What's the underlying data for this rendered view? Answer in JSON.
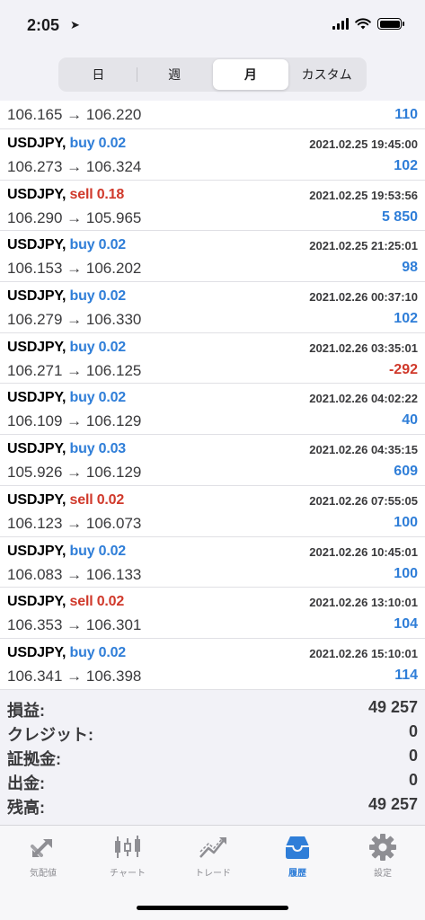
{
  "status": {
    "time": "2:05",
    "time_arrow": "➤"
  },
  "tabs": [
    "日",
    "週",
    "月",
    "カスタム"
  ],
  "active_tab_index": 2,
  "partial_row": {
    "prices": "106.165 → 106.220",
    "profit": "110"
  },
  "deals": [
    {
      "symbol": "USDJPY,",
      "side": "buy",
      "volume": "0.02",
      "datetime": "2021.02.25 19:45:00",
      "prices": "106.273 → 106.324",
      "profit": "102"
    },
    {
      "symbol": "USDJPY,",
      "side": "sell",
      "volume": "0.18",
      "datetime": "2021.02.25 19:53:56",
      "prices": "106.290 → 105.965",
      "profit": "5 850"
    },
    {
      "symbol": "USDJPY,",
      "side": "buy",
      "volume": "0.02",
      "datetime": "2021.02.25 21:25:01",
      "prices": "106.153 → 106.202",
      "profit": "98"
    },
    {
      "symbol": "USDJPY,",
      "side": "buy",
      "volume": "0.02",
      "datetime": "2021.02.26 00:37:10",
      "prices": "106.279 → 106.330",
      "profit": "102"
    },
    {
      "symbol": "USDJPY,",
      "side": "buy",
      "volume": "0.02",
      "datetime": "2021.02.26 03:35:01",
      "prices": "106.271 → 106.125",
      "profit": "-292"
    },
    {
      "symbol": "USDJPY,",
      "side": "buy",
      "volume": "0.02",
      "datetime": "2021.02.26 04:02:22",
      "prices": "106.109 → 106.129",
      "profit": "40"
    },
    {
      "symbol": "USDJPY,",
      "side": "buy",
      "volume": "0.03",
      "datetime": "2021.02.26 04:35:15",
      "prices": "105.926 → 106.129",
      "profit": "609"
    },
    {
      "symbol": "USDJPY,",
      "side": "sell",
      "volume": "0.02",
      "datetime": "2021.02.26 07:55:05",
      "prices": "106.123 → 106.073",
      "profit": "100"
    },
    {
      "symbol": "USDJPY,",
      "side": "buy",
      "volume": "0.02",
      "datetime": "2021.02.26 10:45:01",
      "prices": "106.083 → 106.133",
      "profit": "100"
    },
    {
      "symbol": "USDJPY,",
      "side": "sell",
      "volume": "0.02",
      "datetime": "2021.02.26 13:10:01",
      "prices": "106.353 → 106.301",
      "profit": "104"
    },
    {
      "symbol": "USDJPY,",
      "side": "buy",
      "volume": "0.02",
      "datetime": "2021.02.26 15:10:01",
      "prices": "106.341 → 106.398",
      "profit": "114"
    }
  ],
  "summary": [
    {
      "label": "損益:",
      "value": "49 257"
    },
    {
      "label": "クレジット:",
      "value": "0"
    },
    {
      "label": "証拠金:",
      "value": "0"
    },
    {
      "label": "出金:",
      "value": "0"
    },
    {
      "label": "残高:",
      "value": "49 257"
    }
  ],
  "tabbar": [
    {
      "label": "気配値",
      "icon": "quotes-icon"
    },
    {
      "label": "チャート",
      "icon": "chart-icon"
    },
    {
      "label": "トレード",
      "icon": "trade-icon"
    },
    {
      "label": "履歴",
      "icon": "history-icon"
    },
    {
      "label": "設定",
      "icon": "settings-icon"
    }
  ],
  "active_tabbar_index": 3,
  "colors": {
    "buy": "#2f7ed8",
    "sell": "#d0392b",
    "active": "#2f7ed8",
    "inactive": "#8e8e93"
  }
}
